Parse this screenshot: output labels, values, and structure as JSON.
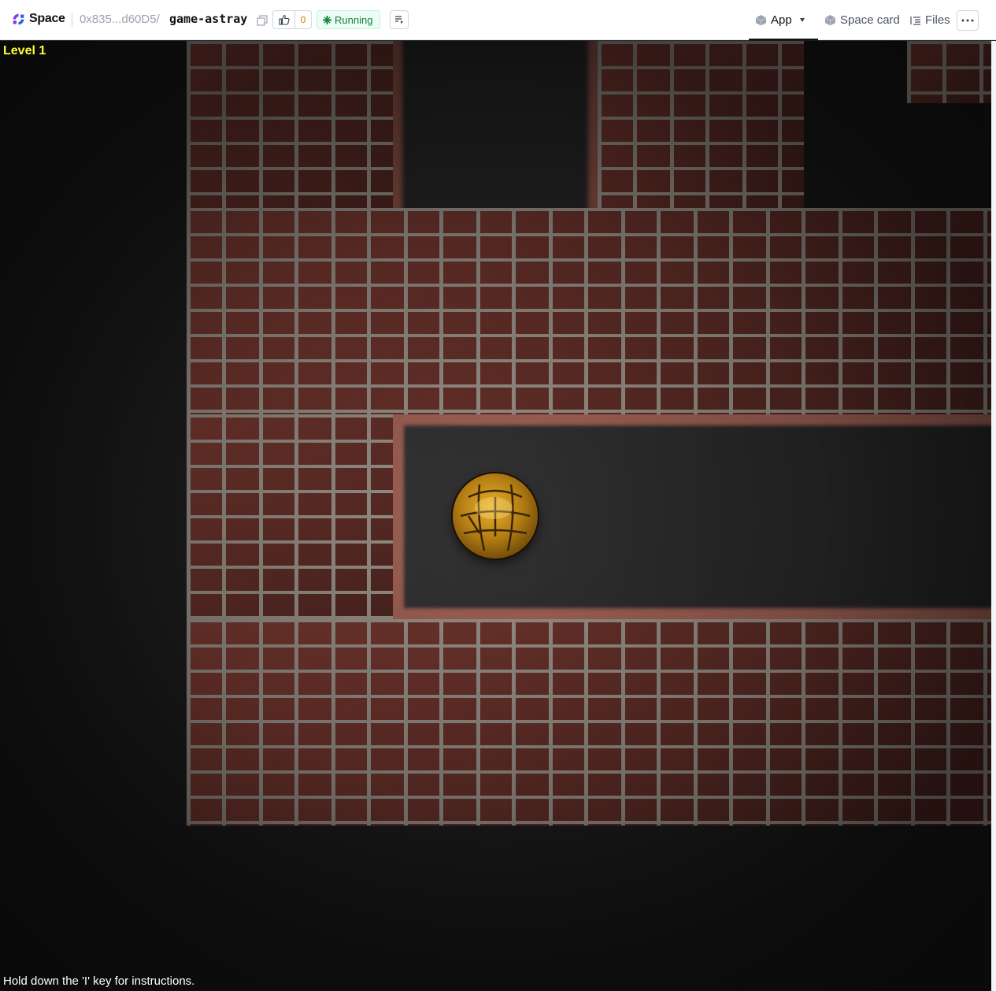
{
  "header": {
    "brand": "Space",
    "owner": "0x835...d60D5",
    "separator": "/",
    "repo": "game-astray",
    "likes": "0",
    "status": "Running",
    "tabs": {
      "app": "App",
      "space_card": "Space card",
      "files": "Files"
    }
  },
  "game": {
    "level": "Level 1",
    "hint": "Hold down the 'I' key for instructions."
  },
  "colors": {
    "level_text": "#ffff33",
    "status_green": "#15803d",
    "like_count": "#d97706"
  },
  "icons": [
    "spaces-logo-icon",
    "copy-icon",
    "thumbs-up-icon",
    "running-icon",
    "logs-icon",
    "cube-icon",
    "caret-down-icon",
    "files-icon",
    "ellipsis-icon"
  ]
}
